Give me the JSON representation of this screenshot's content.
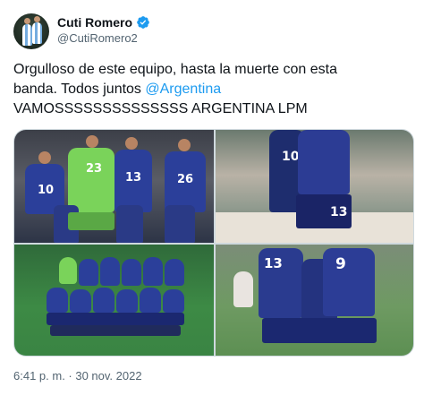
{
  "author": {
    "display_name": "Cuti Romero",
    "handle": "@CutiRomero2",
    "verified": true,
    "avatar_icon": "profile-photo"
  },
  "tweet": {
    "line1": "Orgulloso de este equipo, hasta la muerte con esta",
    "line2_text": "banda.  Todos juntos ",
    "line2_mention": "@Argentina",
    "line3": "VAMOSSSSSSSSSSSSSS ARGENTINA LPM"
  },
  "media": {
    "photos": [
      {
        "jersey_numbers": [
          "10",
          "23",
          "13",
          "26"
        ]
      },
      {
        "jersey_numbers": [
          "10",
          "13"
        ]
      },
      {
        "jersey_numbers": []
      },
      {
        "jersey_numbers": [
          "13",
          "9"
        ]
      }
    ]
  },
  "meta": {
    "timestamp": "6:41 p. m. · 30 nov. 2022"
  },
  "colors": {
    "accent": "#1d9bf0",
    "text_primary": "#0f1419",
    "text_secondary": "#536471",
    "kit_away": "#2b3f9a",
    "gk_kit": "#7ad35a"
  }
}
